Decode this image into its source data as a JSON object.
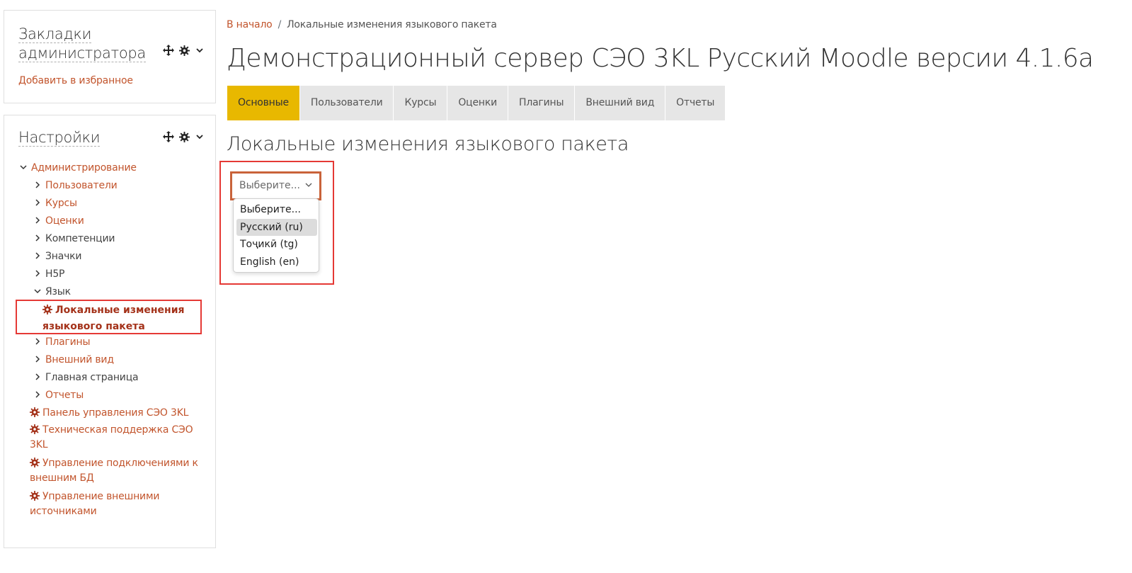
{
  "bookmarks_block": {
    "title": "Закладки администратора",
    "add_link": "Добавить в избранное"
  },
  "settings_block": {
    "title": "Настройки",
    "tree": {
      "admin": "Администрирование",
      "users": "Пользователи",
      "courses": "Курсы",
      "grades": "Оценки",
      "competencies": "Компетенции",
      "badges": "Значки",
      "h5p": "H5P",
      "language": "Язык",
      "lang_customization": "Локальные изменения языкового пакета",
      "plugins": "Плагины",
      "appearance": "Внешний вид",
      "frontpage": "Главная страница",
      "reports": "Отчеты",
      "seo_panel": "Панель управления СЭО 3KL",
      "seo_support": "Техническая поддержка СЭО 3KL",
      "db_connections": "Управление подключениями к внешним БД",
      "ext_sources": "Управление внешними источниками"
    }
  },
  "breadcrumb": {
    "home": "В начало",
    "separator": "/",
    "current": "Локальные изменения языкового пакета"
  },
  "page_title": "Демонстрационный сервер СЭО 3KL Русский Moodle версии 4.1.6a",
  "tabs": [
    "Основные",
    "Пользователи",
    "Курсы",
    "Оценки",
    "Плагины",
    "Внешний вид",
    "Отчеты"
  ],
  "section_title": "Локальные изменения языкового пакета",
  "language_select": {
    "value": "Выберите...",
    "options": [
      "Выберите...",
      "Русский (ru)",
      "Тоҷикӣ (tg)",
      "English (en)"
    ],
    "highlighted_option": "Русский (ru)"
  },
  "colors": {
    "link": "#c2552d",
    "active_tab": "#e8b800",
    "highlight_border": "#e53935"
  }
}
